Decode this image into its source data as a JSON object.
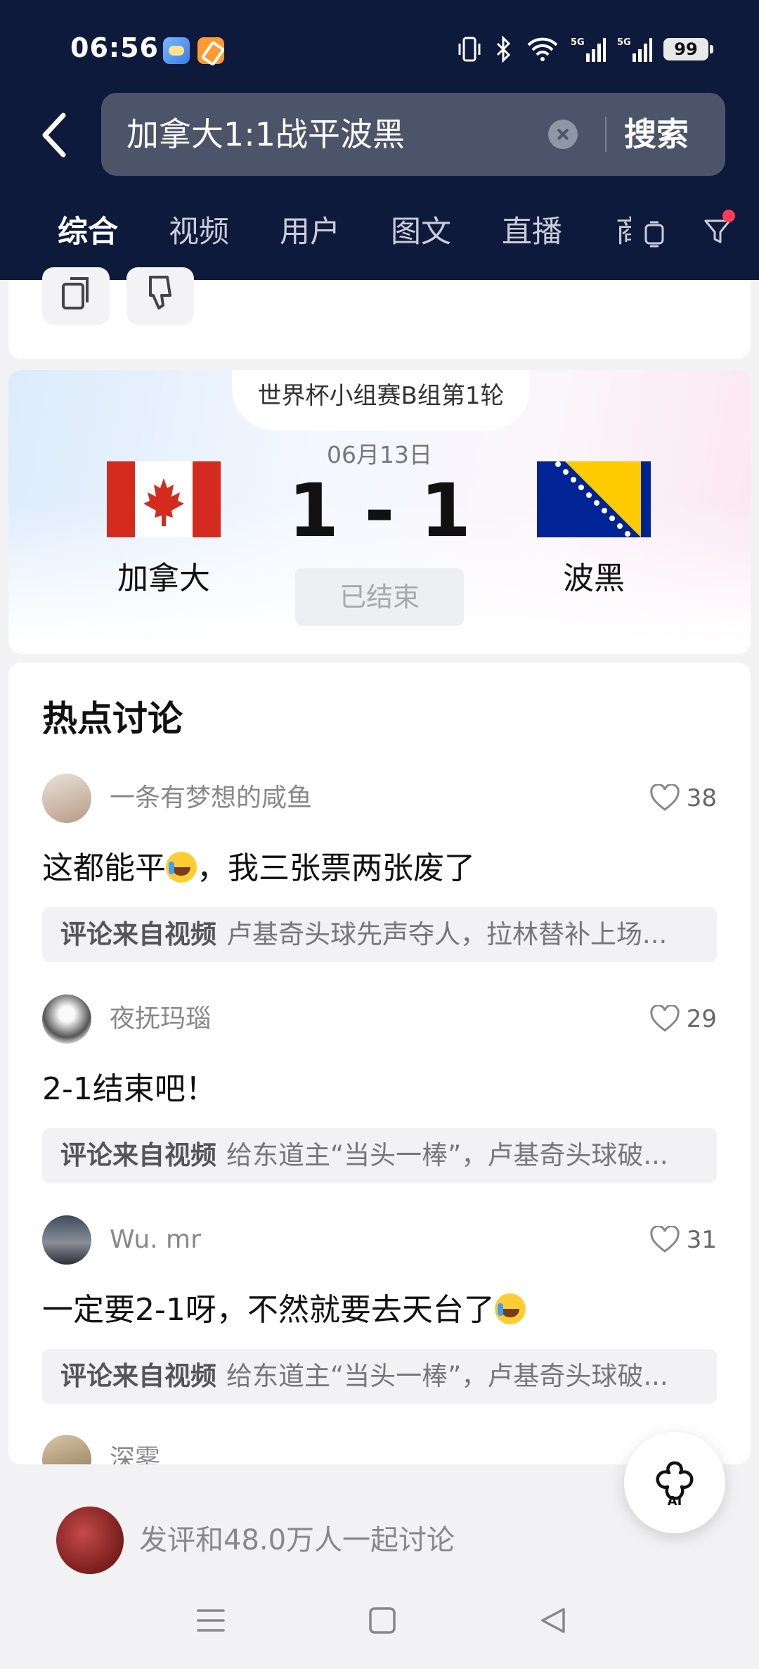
{
  "status_bar": {
    "time": "06:56",
    "battery": "99"
  },
  "search": {
    "query": "加拿大1:1战平波黑",
    "button": "搜索"
  },
  "tabs": [
    "综合",
    "视频",
    "用户",
    "图文",
    "直播",
    "商"
  ],
  "match": {
    "stage": "世界杯小组赛B组第1轮",
    "date": "06月13日",
    "score": "1 - 1",
    "status": "已结束",
    "home": "加拿大",
    "away": "波黑"
  },
  "hot": {
    "title": "热点讨论",
    "source_label": "评论来自视频",
    "comments": [
      {
        "user": "一条有梦想的咸鱼",
        "likes": "38",
        "text": "这都能平",
        "text_after": "，我三张票两张废了",
        "source": "卢基奇头球先声夺人，拉林替补上场..."
      },
      {
        "user": "夜抚玛瑙",
        "likes": "29",
        "text": "2-1结束吧！",
        "text_after": "",
        "source": "给东道主“当头一棒”，卢基奇头球破..."
      },
      {
        "user": "Wu. mr",
        "likes": "31",
        "text": "一定要2-1呀，不然就要去天台了",
        "text_after": "",
        "source": "给东道主“当头一棒”，卢基奇头球破..."
      },
      {
        "user": "深雾",
        "likes": "",
        "text": "",
        "text_after": "",
        "source": ""
      }
    ]
  },
  "compose": {
    "placeholder": "发评和48.0万人一起讨论"
  },
  "ai_button": {
    "label": "AI"
  },
  "colors": {
    "header_bg": "#0e1a3c",
    "accent_red": "#ff3b5c"
  }
}
